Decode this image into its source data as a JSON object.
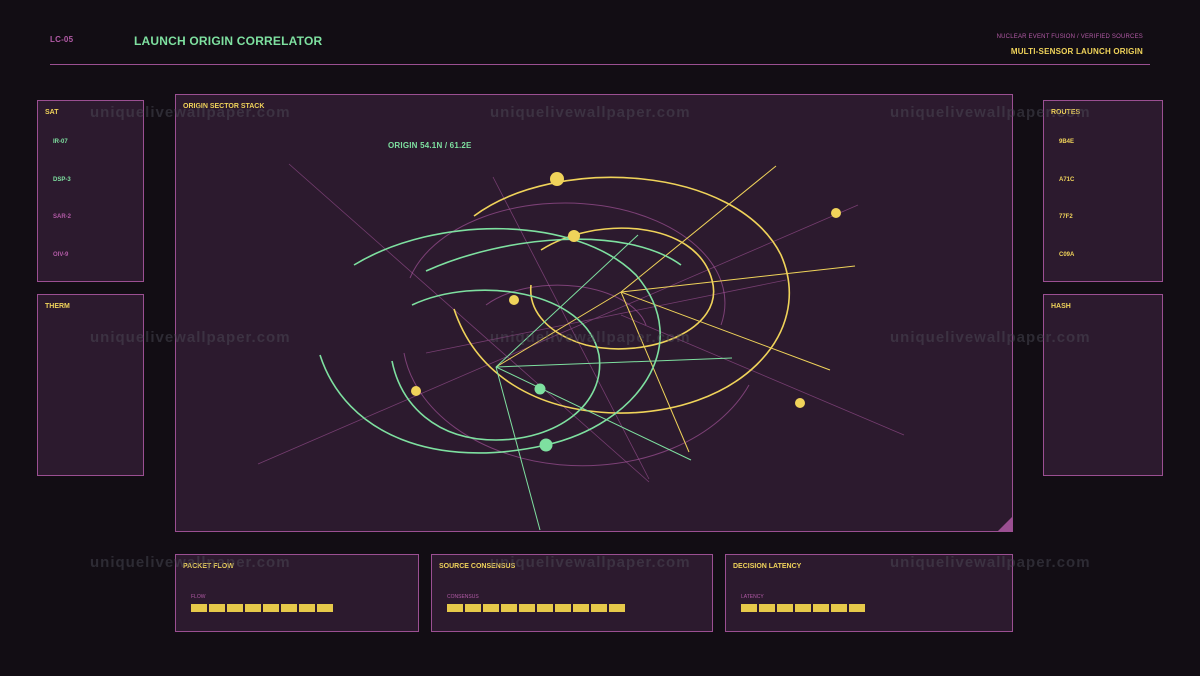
{
  "header": {
    "code": "LC-05",
    "title": "LAUNCH ORIGIN CORRELATOR",
    "subtitle": "NUCLEAR EVENT FUSION / VERIFIED SOURCES",
    "mode": "MULTI-SENSOR LAUNCH ORIGIN"
  },
  "colors": {
    "background": "#120d14",
    "panel": "#2c1a2e",
    "border": "#9b4f92",
    "green": "#7ee0a0",
    "yellow": "#f0d35a",
    "magenta": "#b25aa6"
  },
  "left": {
    "sat": {
      "title": "SAT",
      "items": [
        {
          "label": "IR-07",
          "color": "#7ee0a0"
        },
        {
          "label": "DSP-3",
          "color": "#7ee0a0"
        },
        {
          "label": "SAR-2",
          "color": "#b25aa6"
        },
        {
          "label": "OIV-9",
          "color": "#b25aa6"
        }
      ]
    },
    "therm": {
      "title": "THERM"
    }
  },
  "right": {
    "routes": {
      "title": "ROUTES",
      "items": [
        "9B4E",
        "A71C",
        "77F2",
        "C09A"
      ]
    },
    "hash": {
      "title": "HASH"
    }
  },
  "main": {
    "title": "ORIGIN SECTOR STACK",
    "origin_label": "ORIGIN 54.1N / 61.2E"
  },
  "bottom": {
    "packet_flow": {
      "title": "PACKET FLOW",
      "meter_label": "FLOW",
      "segments": 8
    },
    "source_consensus": {
      "title": "SOURCE CONSENSUS",
      "meter_label": "CONSENSUS",
      "segments": 10
    },
    "decision_latency": {
      "title": "DECISION LATENCY",
      "meter_label": "LATENCY",
      "segments": 7
    }
  },
  "watermark": "uniquelivewallpaper.com"
}
